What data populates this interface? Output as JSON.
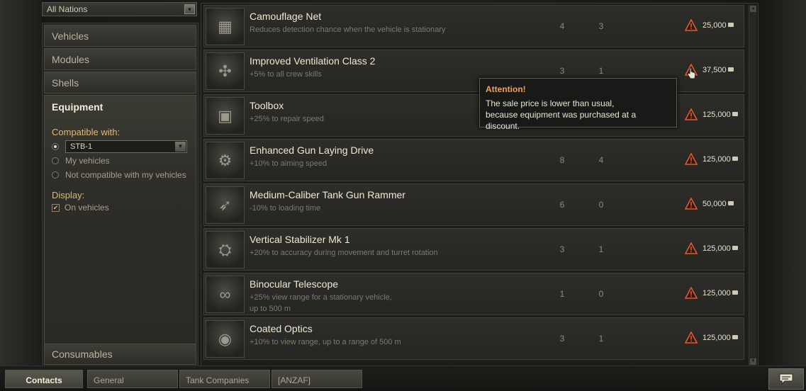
{
  "filters": {
    "nation_select": "All Nations",
    "categories": [
      "Vehicles",
      "Modules",
      "Shells"
    ],
    "active_category": "Equipment",
    "compatible_label": "Compatible with:",
    "vehicle_select": "STB-1",
    "radio_my_vehicles": "My vehicles",
    "radio_not_compatible": "Not compatible with my vehicles",
    "display_label": "Display:",
    "on_vehicles": "On vehicles",
    "bottom_category": "Consumables"
  },
  "items": [
    {
      "name": "Camouflage Net",
      "desc": "Reduces detection chance when the vehicle is stationary",
      "n1": "4",
      "n2": "3",
      "price": "25,000",
      "icon": "camouflage-net-icon",
      "glyph": "▦"
    },
    {
      "name": "Improved Ventilation Class 2",
      "desc": "+5% to all crew skills",
      "n1": "3",
      "n2": "1",
      "price": "37,500",
      "icon": "ventilation-fan-icon",
      "glyph": "✣"
    },
    {
      "name": "Toolbox",
      "desc": "+25% to repair speed",
      "n1": "",
      "n2": "",
      "price": "125,000",
      "icon": "toolbox-icon",
      "glyph": "▣"
    },
    {
      "name": "Enhanced Gun Laying Drive",
      "desc": "+10% to aiming speed",
      "n1": "8",
      "n2": "4",
      "price": "125,000",
      "icon": "gun-laying-drive-icon",
      "glyph": "⚙"
    },
    {
      "name": "Medium-Caliber Tank Gun Rammer",
      "desc": "-10% to loading time",
      "n1": "6",
      "n2": "0",
      "price": "50,000",
      "icon": "gun-rammer-icon",
      "glyph": "➶"
    },
    {
      "name": "Vertical Stabilizer Mk 1",
      "desc": "+20% to accuracy during movement and turret rotation",
      "n1": "3",
      "n2": "1",
      "price": "125,000",
      "icon": "stabilizer-icon",
      "glyph": "⛭"
    },
    {
      "name": "Binocular Telescope",
      "desc": "+25% view range for a stationary vehicle,",
      "desc2": "up to 500 m",
      "n1": "1",
      "n2": "0",
      "price": "125,000",
      "icon": "binocular-telescope-icon",
      "glyph": "∞"
    },
    {
      "name": "Coated Optics",
      "desc": "+10% to view range, up to a range of 500 m",
      "n1": "3",
      "n2": "1",
      "price": "125,000",
      "icon": "coated-optics-icon",
      "glyph": "◉"
    }
  ],
  "tooltip": {
    "title": "Attention!",
    "line1": "The sale price is lower than usual,",
    "line2": "because equipment was purchased at a discount."
  },
  "chat": {
    "tabs": [
      "Contacts",
      "General",
      "Tank Companies",
      "[ANZAF]"
    ]
  },
  "colors": {
    "warning": "#e05a2a",
    "tooltip_title": "#f0a253",
    "filter_label": "#e0b97a"
  }
}
